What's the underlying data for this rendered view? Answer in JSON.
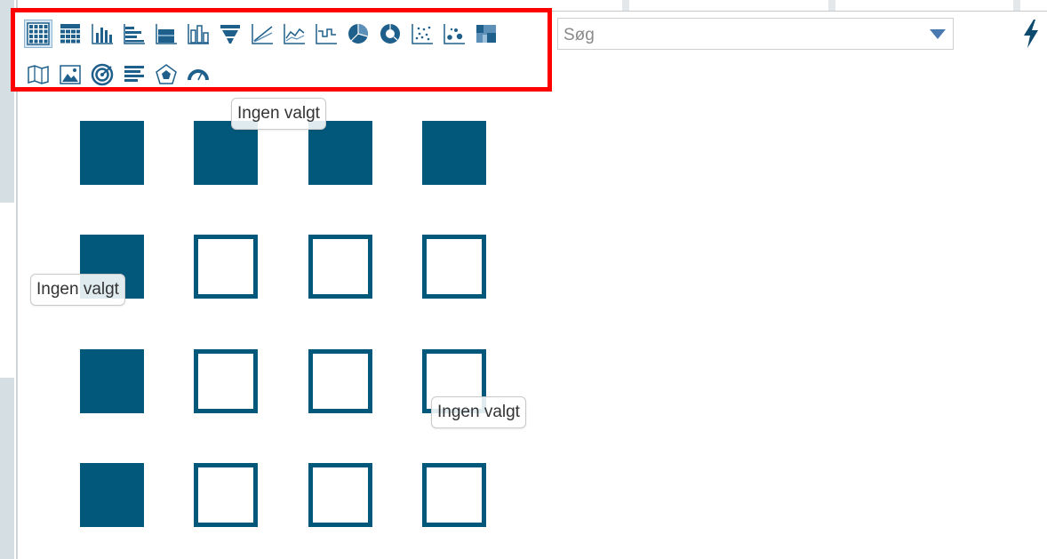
{
  "toolbar": {
    "row1": [
      {
        "name": "table-grid-icon",
        "selected": true
      },
      {
        "name": "pivot-grid-icon"
      },
      {
        "name": "column-chart-icon"
      },
      {
        "name": "bar-chart-icon"
      },
      {
        "name": "stacked-bar-icon"
      },
      {
        "name": "stacked-column-icon"
      },
      {
        "name": "funnel-icon"
      },
      {
        "name": "line-chart-icon"
      },
      {
        "name": "line-combo-icon"
      },
      {
        "name": "step-line-icon"
      },
      {
        "name": "pie-chart-icon"
      },
      {
        "name": "donut-chart-icon"
      },
      {
        "name": "scatter-plot-icon"
      },
      {
        "name": "bubble-chart-icon"
      },
      {
        "name": "heatmap-icon"
      }
    ],
    "row2": [
      {
        "name": "map-icon"
      },
      {
        "name": "image-icon"
      },
      {
        "name": "target-icon"
      },
      {
        "name": "list-icon"
      },
      {
        "name": "radar-icon"
      },
      {
        "name": "gauge-icon"
      }
    ]
  },
  "search": {
    "placeholder": "Søg",
    "value": ""
  },
  "icons": {
    "dropdown": "chevron-down-icon",
    "action": "lightning-icon"
  },
  "colors": {
    "accent": "#02587a",
    "highlight": "#ff0000"
  },
  "grid": [
    [
      "filled",
      "filled",
      "filled",
      "filled"
    ],
    [
      "filled",
      "empty",
      "empty",
      "empty"
    ],
    [
      "filled",
      "empty",
      "empty",
      "empty"
    ],
    [
      "filled",
      "empty",
      "empty",
      "empty"
    ]
  ],
  "tooltips": [
    {
      "text": "Ingen valgt"
    },
    {
      "text": "Ingen valgt"
    },
    {
      "text": "Ingen valgt"
    }
  ]
}
